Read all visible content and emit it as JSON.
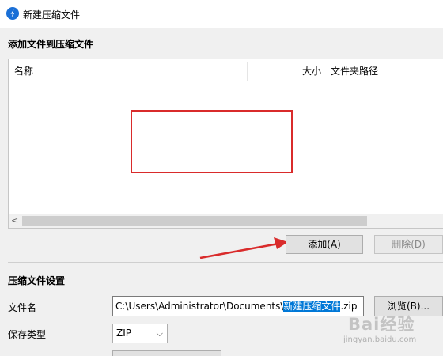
{
  "window": {
    "title": "新建压缩文件"
  },
  "add_section": {
    "title": "添加文件到压缩文件",
    "columns": [
      "名称",
      "大小",
      "文件夹路径"
    ],
    "scroll_left_glyph": "<"
  },
  "buttons": {
    "add": "添加(A)",
    "delete": "删除(D)",
    "browse": "浏览(B)..."
  },
  "settings": {
    "title": "压缩文件设置",
    "filename_label": "文件名",
    "filename_prefix": "C:\\Users\\Administrator\\Documents\\",
    "filename_selected": "新建压缩文件",
    "filename_suffix": ".zip",
    "save_type_label": "保存类型",
    "save_type_value": "ZIP"
  },
  "watermark": {
    "brand": "Bai经验",
    "url": "jingyan.baidu.com"
  },
  "colors": {
    "annotation": "#d92b2b",
    "selection": "#0078d7",
    "app_icon": "#1a6fd6"
  }
}
